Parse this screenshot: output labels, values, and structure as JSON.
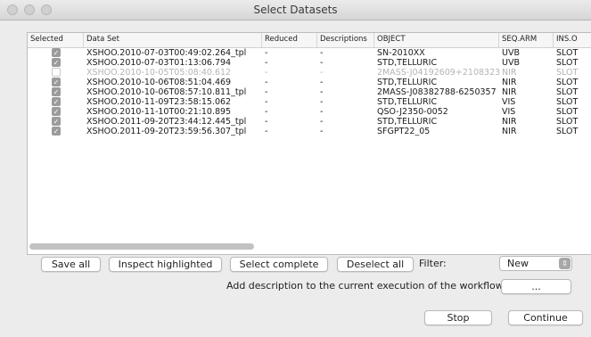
{
  "window": {
    "title": "Select Datasets"
  },
  "table": {
    "columns": [
      "Selected",
      "Data Set",
      "Reduced",
      "Descriptions",
      "OBJECT",
      "SEQ.ARM",
      "INS.O"
    ],
    "rows": [
      {
        "selected": true,
        "enabled": true,
        "dataset": "XSHOO.2010-07-03T00:49:02.264_tpl",
        "reduced": "-",
        "descriptions": "-",
        "object": "SN-2010XX",
        "seq_arm": "UVB",
        "ins": "SLOT"
      },
      {
        "selected": true,
        "enabled": true,
        "dataset": "XSHOO.2010-07-03T01:13:06.794",
        "reduced": "-",
        "descriptions": "-",
        "object": "STD,TELLURIC",
        "seq_arm": "UVB",
        "ins": "SLOT"
      },
      {
        "selected": false,
        "enabled": false,
        "dataset": "XSHOO.2010-10-05T05:08:40.612",
        "reduced": "-",
        "descriptions": "-",
        "object": "2MASS-J04192609+2108323",
        "seq_arm": "NIR",
        "ins": "SLOT"
      },
      {
        "selected": true,
        "enabled": true,
        "dataset": "XSHOO.2010-10-06T08:51:04.469",
        "reduced": "-",
        "descriptions": "-",
        "object": "STD,TELLURIC",
        "seq_arm": "NIR",
        "ins": "SLOT"
      },
      {
        "selected": true,
        "enabled": true,
        "dataset": "XSHOO.2010-10-06T08:57:10.811_tpl",
        "reduced": "-",
        "descriptions": "-",
        "object": "2MASS-J08382788-6250357",
        "seq_arm": "NIR",
        "ins": "SLOT"
      },
      {
        "selected": true,
        "enabled": true,
        "dataset": "XSHOO.2010-11-09T23:58:15.062",
        "reduced": "-",
        "descriptions": "-",
        "object": "STD,TELLURIC",
        "seq_arm": "VIS",
        "ins": "SLOT"
      },
      {
        "selected": true,
        "enabled": true,
        "dataset": "XSHOO.2010-11-10T00:21:10.895",
        "reduced": "-",
        "descriptions": "-",
        "object": "QSO-J2350-0052",
        "seq_arm": "VIS",
        "ins": "SLOT"
      },
      {
        "selected": true,
        "enabled": true,
        "dataset": "XSHOO.2011-09-20T23:44:12.445_tpl",
        "reduced": "-",
        "descriptions": "-",
        "object": "STD,TELLURIC",
        "seq_arm": "NIR",
        "ins": "SLOT"
      },
      {
        "selected": true,
        "enabled": true,
        "dataset": "XSHOO.2011-09-20T23:59:56.307_tpl",
        "reduced": "-",
        "descriptions": "-",
        "object": "SFGPT22_05",
        "seq_arm": "NIR",
        "ins": "SLOT"
      }
    ]
  },
  "toolbar": {
    "save_all": "Save all",
    "inspect_highlighted": "Inspect highlighted",
    "select_complete": "Select complete",
    "deselect_all": "Deselect all",
    "filter_label": "Filter:",
    "filter_value": "New"
  },
  "description": {
    "label": "Add description to the current execution of the workflow:",
    "button": "..."
  },
  "footer": {
    "stop": "Stop",
    "continue": "Continue"
  }
}
